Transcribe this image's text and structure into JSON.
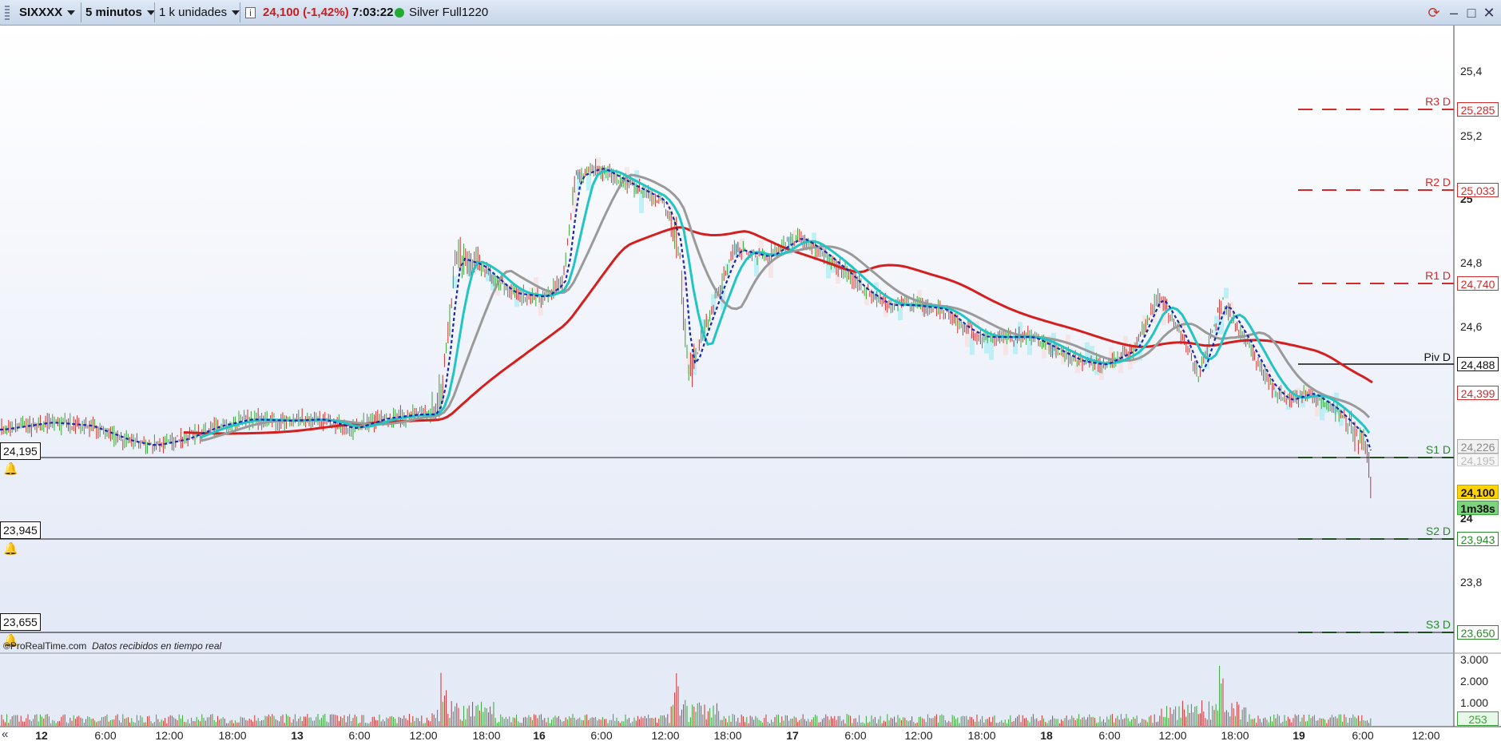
{
  "toolbar": {
    "symbol": "SIXXXX",
    "timeframe": "5 minutos",
    "units": "1 k unidades",
    "price": "24,100",
    "change": "(-1,42%)",
    "time": "7:03:22",
    "account": "Silver Full1220"
  },
  "footer_text": {
    "brand": "©ProRealTime.com",
    "status": "Datos recibidos en tiempo real"
  },
  "price_axis": [
    "25,4",
    "25,2",
    "25",
    "24,8",
    "24,6",
    "24",
    "23,8"
  ],
  "volume_axis": [
    "3.000",
    "2.000",
    "1.000"
  ],
  "time_axis": [
    "12",
    "6:00",
    "12:00",
    "18:00",
    "13",
    "6:00",
    "12:00",
    "18:00",
    "16",
    "6:00",
    "12:00",
    "18:00",
    "17",
    "6:00",
    "12:00",
    "18:00",
    "18",
    "6:00",
    "12:00",
    "18:00",
    "19",
    "6:00",
    "12:00"
  ],
  "pivots": [
    {
      "name": "R3 D",
      "value": "25,285",
      "color": "#d42a2a"
    },
    {
      "name": "R2 D",
      "value": "25,033",
      "color": "#d42a2a"
    },
    {
      "name": "R1 D",
      "value": "24,740",
      "color": "#d42a2a"
    },
    {
      "name": "Piv D",
      "value": "24,488",
      "color": "#111111"
    },
    {
      "name": "S1 D",
      "value": "",
      "color": "#2a8a2a"
    },
    {
      "name": "S2 D",
      "value": "23,943",
      "color": "#2a8a2a"
    },
    {
      "name": "S3 D",
      "value": "23,650",
      "color": "#2a8a2a"
    }
  ],
  "price_tags": {
    "ma_red": "24,399",
    "ma_gray": "24,226",
    "ma_faded": "24,195",
    "last": "24,100",
    "countdown": "1m38s",
    "volume_last": "253"
  },
  "alerts": [
    {
      "value": "24,195"
    },
    {
      "value": "23,945"
    },
    {
      "value": "23,655"
    }
  ],
  "colors": {
    "up": "#3aa33a",
    "down": "#d03030",
    "ma_slow": "#d41f1f",
    "ma_mid": "#9a9a9a",
    "ma_fast": "#22c4c4",
    "dotted": "#1a2aa8",
    "cloud": "#a8ecf5"
  },
  "icons": [
    "bell-icon",
    "info-icon",
    "refresh-icon",
    "minimize-icon",
    "restore-icon",
    "close-icon"
  ]
}
